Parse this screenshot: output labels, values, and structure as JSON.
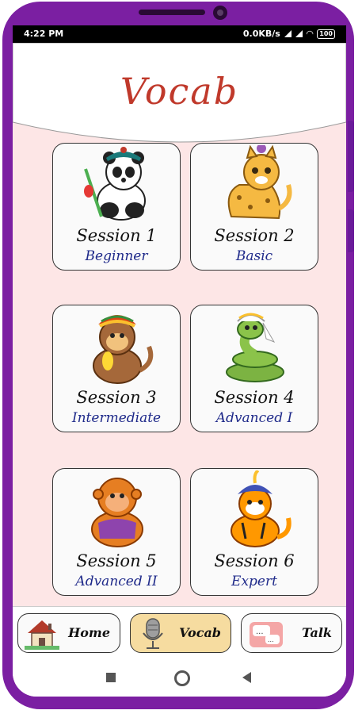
{
  "status_bar": {
    "time": "4:22 PM",
    "net_speed": "0.0KB/s",
    "battery": "100"
  },
  "header": {
    "title": "Vocab"
  },
  "sessions": [
    {
      "name": "Session 1",
      "level": "Beginner",
      "icon": "panda-icon"
    },
    {
      "name": "Session 2",
      "level": "Basic",
      "icon": "cheetah-icon"
    },
    {
      "name": "Session 3",
      "level": "Intermediate",
      "icon": "monkey-icon"
    },
    {
      "name": "Session 4",
      "level": "Advanced I",
      "icon": "snake-icon"
    },
    {
      "name": "Session 5",
      "level": "Advanced II",
      "icon": "orangutan-icon"
    },
    {
      "name": "Session 6",
      "level": "Expert",
      "icon": "tiger-icon"
    }
  ],
  "bottom_nav": {
    "tabs": [
      {
        "label": "Home",
        "icon": "house-icon",
        "active": false
      },
      {
        "label": "Vocab",
        "icon": "microphone-icon",
        "active": true
      },
      {
        "label": "Talk",
        "icon": "chat-bubble-icon",
        "active": false
      }
    ]
  },
  "colors": {
    "frame": "#7b1fa2",
    "background": "#fde6e6",
    "title": "#c0392b",
    "level_text": "#1f2a8a",
    "active_tab": "#f6dca0"
  }
}
